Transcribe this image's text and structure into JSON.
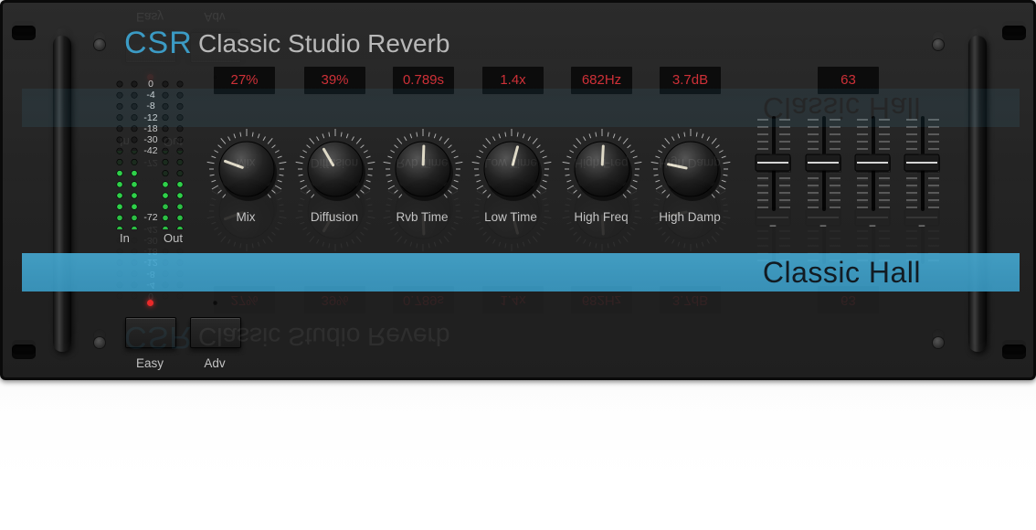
{
  "brand": {
    "short": "CSR",
    "product": "Classic Studio Reverb"
  },
  "displays": [
    {
      "name": "mix-display",
      "value": "27%"
    },
    {
      "name": "diffusion-display",
      "value": "39%"
    },
    {
      "name": "rvb-time-display",
      "value": "0.789s"
    },
    {
      "name": "low-time-display",
      "value": "1.4x"
    },
    {
      "name": "high-freq-display",
      "value": "682Hz"
    },
    {
      "name": "high-damp-display",
      "value": "3.7dB"
    },
    {
      "name": "fader-value-display",
      "value": "63"
    }
  ],
  "knobs": [
    {
      "name": "mix",
      "label": "Mix",
      "angle_deg": -70
    },
    {
      "name": "diffusion",
      "label": "Diffusion",
      "angle_deg": -30
    },
    {
      "name": "rvb-time",
      "label": "Rvb Time",
      "angle_deg": 2
    },
    {
      "name": "low-time",
      "label": "Low Time",
      "angle_deg": 15
    },
    {
      "name": "high-freq",
      "label": "High Freq",
      "angle_deg": 3
    },
    {
      "name": "high-damp",
      "label": "High Damp",
      "angle_deg": -78
    }
  ],
  "meter": {
    "scale": [
      "0",
      "-4",
      "-8",
      "-12",
      "-18",
      "-30",
      "-42",
      "-72"
    ],
    "in_label": "In",
    "out_label": "Out",
    "in_lit_steps": 6,
    "out_lit_steps": 5,
    "lit_color": "#2fd04a",
    "unlit_color": "#1a1a1a"
  },
  "faders": [
    {
      "name": "fader-1",
      "value_label": "–",
      "level": 0.5
    },
    {
      "name": "fader-2",
      "value_label": "–",
      "level": 0.5
    },
    {
      "name": "fader-3",
      "value_label": "–",
      "level": 0.5
    },
    {
      "name": "fader-4",
      "value_label": "–",
      "level": 0.5
    }
  ],
  "preset": {
    "name": "Classic Hall",
    "color": "#3fa3cd"
  },
  "modes": [
    {
      "name": "easy",
      "label": "Easy",
      "led_on": true
    },
    {
      "name": "adv",
      "label": "Adv",
      "led_on": false
    }
  ],
  "colors": {
    "accent": "#3fa8d6",
    "display_text": "#e0323a",
    "led_on": "#ff2a2a"
  }
}
